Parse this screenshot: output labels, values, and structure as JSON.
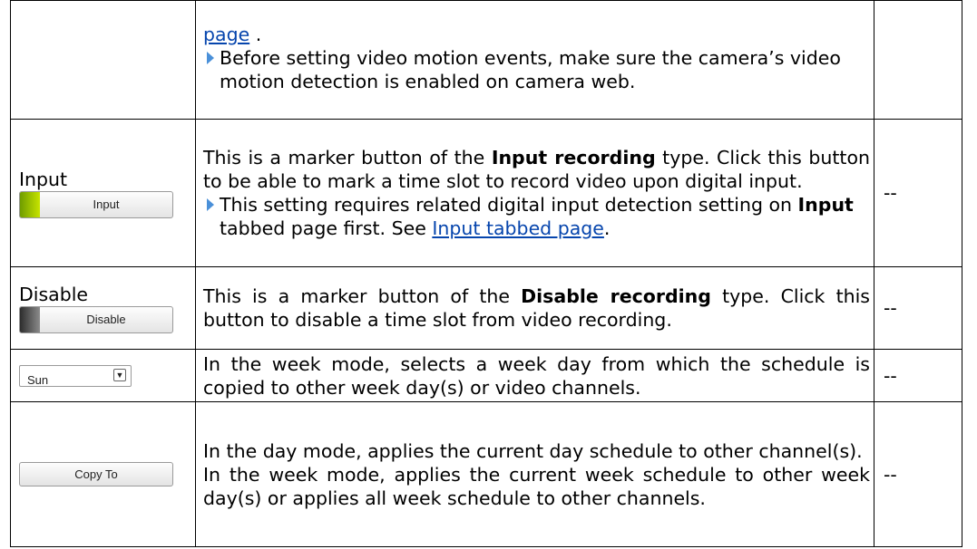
{
  "rows": [
    {
      "page_link": "page",
      "page_after": " .",
      "bullet": "Before setting video motion events, make sure the camera’s video motion detection is enabled on camera web.",
      "value": ""
    },
    {
      "label": "Input",
      "button": "Input",
      "desc_pre": "This is a marker button of the ",
      "desc_bold": "Input recording",
      "desc_post": " type. Click this button to be able to mark a time slot to record video upon digital input.",
      "bullet_pre": "This setting requires related digital input detection setting on ",
      "bullet_bold": "Input",
      "bullet_mid": " tabbed page first. See ",
      "bullet_link": "Input tabbed page",
      "bullet_post": ".",
      "value": "--"
    },
    {
      "label": "Disable",
      "button": "Disable",
      "desc_pre": "This is a marker button of the ",
      "desc_bold": "Disable recording",
      "desc_post": " type. Click this button to disable a time slot from video recording.",
      "value": "--"
    },
    {
      "select": "Sun",
      "desc": "In the week mode, selects a week day from which the schedule is copied to other week day(s) or video channels.",
      "value": "--"
    },
    {
      "button": "Copy To",
      "desc1": "In the day mode, applies the current day schedule to other channel(s).",
      "desc2": "In the week mode, applies the current week schedule to other week day(s) or applies all week schedule to other channels.",
      "value": "--"
    }
  ],
  "colors": {
    "link": "#0645ad",
    "bullet": "#4a90d9",
    "input_swatch": "#b5d600",
    "disable_swatch": "#4a4a4a"
  },
  "icons": {
    "bullet": "triangle-right-icon",
    "select_arrow": "chevron-down-icon"
  }
}
